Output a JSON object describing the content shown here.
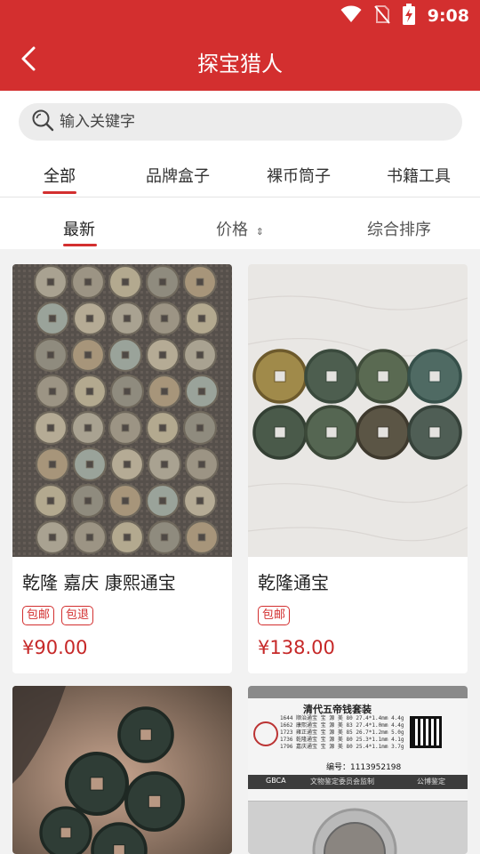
{
  "status": {
    "time": "9:08"
  },
  "nav": {
    "title": "探宝猎人"
  },
  "search": {
    "placeholder": "输入关键字"
  },
  "category_tabs": [
    "全部",
    "品牌盒子",
    "裸币筒子",
    "书籍工具"
  ],
  "sort": {
    "latest": "最新",
    "price": "价格",
    "sort_arrow": "⇕",
    "overall": "综合排序"
  },
  "products": [
    {
      "name": "乾隆 嘉庆 康熙通宝",
      "tags": [
        "包邮",
        "包退"
      ],
      "price": "¥90.00"
    },
    {
      "name": "乾隆通宝",
      "tags": [
        "包邮"
      ],
      "price": "¥138.00"
    }
  ],
  "certificate": {
    "title": "清代五帝钱套装",
    "lines": [
      "1644 顺治通宝 宝 源 美 80 27.4*1.4mm 4.4g",
      "1662 康熙通宝 宝 源 美 83 27.4*1.0mm 4.4g",
      "1723 雍正通宝 宝 源 美 85 26.7*1.2mm 5.0g",
      "1736 乾隆通宝 宝 源 美 80 25.3*1.1mm 4.1g",
      "1796 嘉庆通宝 宝 源 美 80 25.4*1.1mm 3.7g"
    ],
    "serial": "编号：1113952198",
    "org": "GBCA",
    "footer": "文物鉴定委员会监制",
    "footer2": "公博鉴定"
  },
  "colors": {
    "brand": "#d32f2f",
    "price": "#c62828"
  }
}
